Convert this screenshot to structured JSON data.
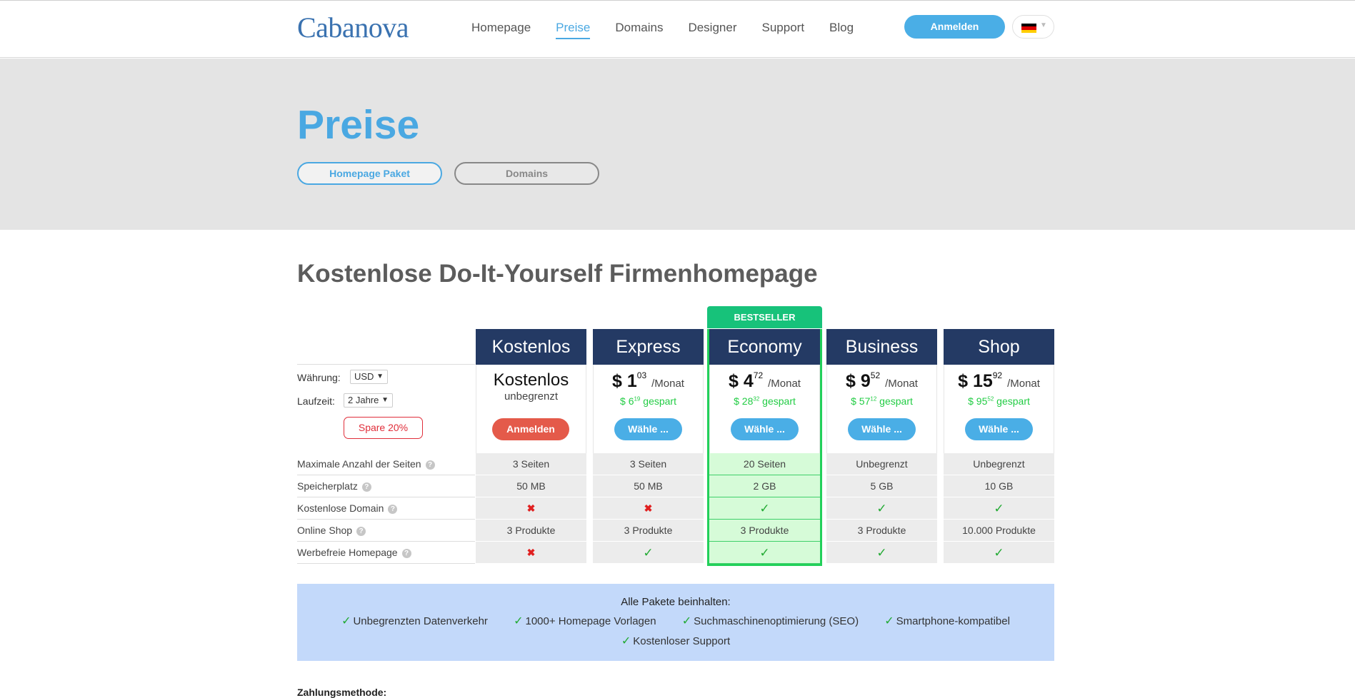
{
  "header": {
    "logo": "Cabanova",
    "nav": [
      {
        "label": "Homepage",
        "active": false
      },
      {
        "label": "Preise",
        "active": true
      },
      {
        "label": "Domains",
        "active": false
      },
      {
        "label": "Designer",
        "active": false
      },
      {
        "label": "Support",
        "active": false
      },
      {
        "label": "Blog",
        "active": false
      }
    ],
    "login_label": "Anmelden",
    "language_flag_icon": "germany-flag-icon"
  },
  "hero": {
    "title": "Preise",
    "tabs": [
      {
        "label": "Homepage Paket",
        "active": true
      },
      {
        "label": "Domains",
        "active": false
      }
    ]
  },
  "pricing": {
    "title": "Kostenlose Do-It-Yourself Firmenhomepage",
    "bestseller_label": "BESTSELLER",
    "currency_label": "Währung:",
    "currency_value": "USD",
    "term_label": "Laufzeit:",
    "term_value": "2 Jahre",
    "save_badge": "Spare 20%",
    "plans": [
      {
        "name": "Kostenlos",
        "price_title": "Kostenlos",
        "price_sub": "unbegrenzt",
        "button": "Anmelden"
      },
      {
        "name": "Express",
        "currency": "$",
        "price_main": "1",
        "price_cents": "03",
        "per": "/Monat",
        "saved_prefix": "$ 6",
        "saved_cents": "19",
        "saved_suffix": " gespart",
        "button": "Wähle ..."
      },
      {
        "name": "Economy",
        "currency": "$",
        "price_main": "4",
        "price_cents": "72",
        "per": "/Monat",
        "saved_prefix": "$ 28",
        "saved_cents": "32",
        "saved_suffix": " gespart",
        "button": "Wähle ..."
      },
      {
        "name": "Business",
        "currency": "$",
        "price_main": "9",
        "price_cents": "52",
        "per": "/Monat",
        "saved_prefix": "$ 57",
        "saved_cents": "12",
        "saved_suffix": " gespart",
        "button": "Wähle ..."
      },
      {
        "name": "Shop",
        "currency": "$",
        "price_main": "15",
        "price_cents": "92",
        "per": "/Monat",
        "saved_prefix": "$ 95",
        "saved_cents": "52",
        "saved_suffix": " gespart",
        "button": "Wähle ..."
      }
    ],
    "features": [
      {
        "label": "Maximale Anzahl der Seiten",
        "values": [
          "3 Seiten",
          "3 Seiten",
          "20 Seiten",
          "Unbegrenzt",
          "Unbegrenzt"
        ]
      },
      {
        "label": "Speicherplatz",
        "values": [
          "50 MB",
          "50 MB",
          "2 GB",
          "5 GB",
          "10 GB"
        ]
      },
      {
        "label": "Kostenlose Domain",
        "values": [
          "no",
          "no",
          "yes",
          "yes",
          "yes"
        ]
      },
      {
        "label": "Online Shop",
        "values": [
          "3 Produkte",
          "3 Produkte",
          "3 Produkte",
          "3 Produkte",
          "10.000 Produkte"
        ]
      },
      {
        "label": "Werbefreie Homepage",
        "values": [
          "no",
          "yes",
          "yes",
          "yes",
          "yes"
        ]
      }
    ],
    "help_icon": "question-mark-icon"
  },
  "includes": {
    "title": "Alle Pakete beinhalten:",
    "items": [
      "Unbegrenzten Datenverkehr",
      "1000+ Homepage Vorlagen",
      "Suchmaschinenoptimierung (SEO)",
      "Smartphone-kompatibel",
      "Kostenloser Support"
    ]
  },
  "payment_label": "Zahlungsmethode:",
  "colors": {
    "accent": "#4aa8e2",
    "plan_header": "#243a64",
    "bestseller": "#17c27a",
    "register": "#e45a4a",
    "saved": "#22cc44"
  }
}
